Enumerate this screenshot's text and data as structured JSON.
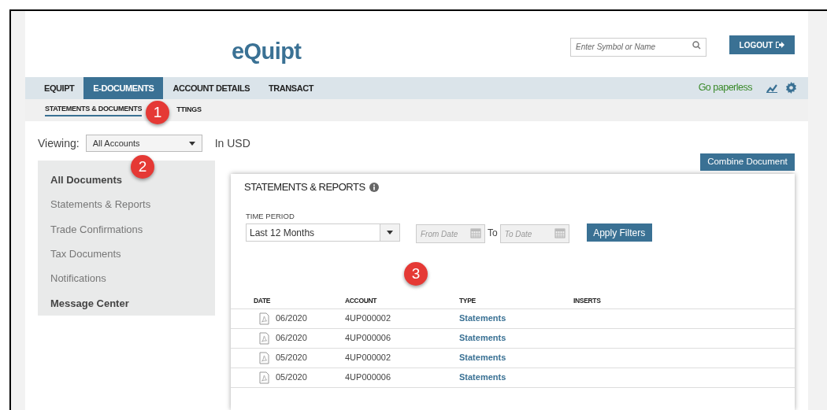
{
  "header": {
    "logo": "eQuipt",
    "search": {
      "placeholder": "Enter Symbol or Name"
    },
    "logout": "LOGOUT"
  },
  "nav": {
    "tabs": [
      {
        "label": "EQUIPT",
        "selected": false
      },
      {
        "label": "E-DOCUMENTS",
        "selected": true
      },
      {
        "label": "ACCOUNT DETAILS",
        "selected": false
      },
      {
        "label": "TRANSACT",
        "selected": false
      }
    ],
    "paperless": "Go paperless"
  },
  "subnav": [
    {
      "label": "STATEMENTS & DOCUMENTS",
      "selected": true
    },
    {
      "label": "TTINGS",
      "selected": false
    }
  ],
  "viewing": {
    "label": "Viewing:",
    "value": "All Accounts",
    "currency": "In USD"
  },
  "combine_button": "Combine Document",
  "sidebar": {
    "items": [
      {
        "label": "All Documents",
        "selected": true
      },
      {
        "label": "Statements & Reports",
        "selected": false
      },
      {
        "label": "Trade Confirmations",
        "selected": false
      },
      {
        "label": "Tax Documents",
        "selected": false
      },
      {
        "label": "Notifications",
        "selected": false
      },
      {
        "label": "Message Center",
        "selected": true
      }
    ]
  },
  "panel": {
    "title": "STATEMENTS & REPORTS",
    "time_period_label": "TIME PERIOD",
    "time_period": "Last 12 Months",
    "from": {
      "placeholder": "From Date"
    },
    "to_label": "To",
    "to": {
      "placeholder": "To Date"
    },
    "apply": "Apply Filters",
    "table": {
      "columns": [
        "DATE",
        "ACCOUNT",
        "TYPE",
        "INSERTS"
      ],
      "rows": [
        [
          "06/2020",
          "4UP000002",
          "Statements"
        ],
        [
          "06/2020",
          "4UP000006",
          "Statements"
        ],
        [
          "05/2020",
          "4UP000002",
          "Statements"
        ],
        [
          "05/2020",
          "4UP000006",
          "Statements"
        ]
      ]
    }
  },
  "badges": [
    "1",
    "2",
    "3"
  ]
}
